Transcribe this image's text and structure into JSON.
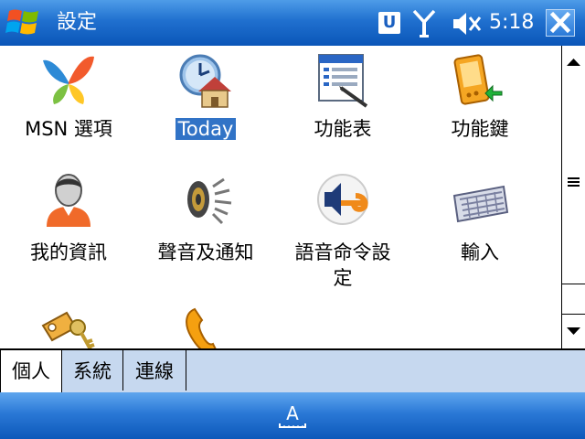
{
  "titlebar": {
    "title": "設定",
    "tray_u": "U",
    "clock": "5:18"
  },
  "applets": [
    {
      "label": "MSN 選項",
      "icon": "msn-butterfly-icon",
      "selected": false
    },
    {
      "label": "Today",
      "icon": "today-clock-house-icon",
      "selected": true
    },
    {
      "label": "功能表",
      "icon": "menus-window-icon",
      "selected": false
    },
    {
      "label": "功能鍵",
      "icon": "buttons-pda-icon",
      "selected": false
    },
    {
      "label": "我的資訊",
      "icon": "owner-info-person-icon",
      "selected": false
    },
    {
      "label": "聲音及通知",
      "icon": "sounds-speaker-icon",
      "selected": false
    },
    {
      "label": "語音命令設定",
      "label_line1": "語音命令設",
      "label_line2": "定",
      "icon": "voice-command-icon",
      "selected": false
    },
    {
      "label": "輸入",
      "icon": "input-keyboard-icon",
      "selected": false
    },
    {
      "label": "",
      "icon": "lock-keys-icon",
      "selected": false
    },
    {
      "label": "",
      "icon": "phone-handset-icon",
      "selected": false
    }
  ],
  "tabs": [
    {
      "label": "個人",
      "active": true
    },
    {
      "label": "系統",
      "active": false
    },
    {
      "label": "連線",
      "active": false
    }
  ],
  "menubar": {
    "sip_label": "A"
  },
  "colors": {
    "titlebar_blue": "#2070cf",
    "selection_blue": "#3173c6",
    "tab_strip": "#c6d8ef"
  }
}
